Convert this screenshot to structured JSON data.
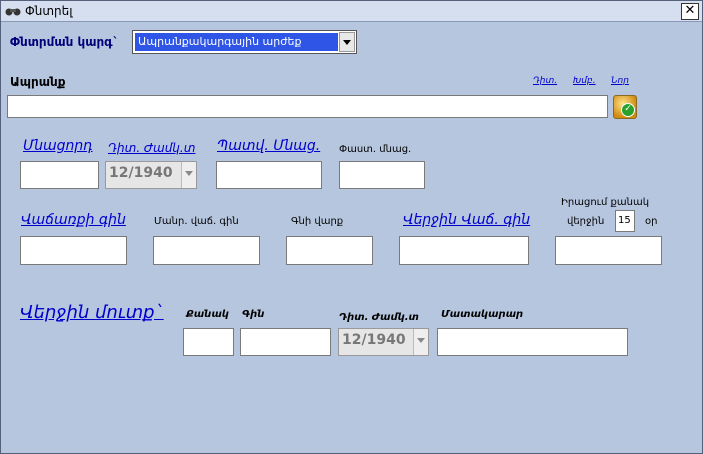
{
  "window": {
    "title": "Փնտրել",
    "close_glyph": "✕"
  },
  "search_type": {
    "label": "Փնտրման կարգ`",
    "value": "Ապրանքակարգային արժեք"
  },
  "product": {
    "label": "Ապրանք",
    "links": {
      "prev": "Դիտ.",
      "edit": "Խմբ.",
      "new": "Նոր"
    },
    "value": ""
  },
  "row1": {
    "remainder_label": "Մնացորդ",
    "period_label": "Դիտ. Ժամկ.տ",
    "period_value": "12/1940",
    "contract_label": "Պատվ. Մնաց.",
    "actual_label": "Փաստ. մնաց."
  },
  "row2": {
    "sale_price_label": "Վաճառքի գին",
    "retail_price_label": "Մանր. վաճ. գին",
    "price_type_label": "Գնի վարք",
    "last_sale_price_label": "Վերջին Վաճ. գին",
    "qty_desc_label": "Իրացում քանակ",
    "last_label": "վերջին",
    "days_value": "15",
    "days_unit": "օր"
  },
  "last_entry": {
    "label": "Վերջին մուտք`",
    "qty_label": "Քանակ",
    "price_label": "Գին",
    "period_label": "Դիտ. Ժամկ.տ",
    "period_value": "12/1940",
    "supplier_label": "Մատակարար"
  }
}
